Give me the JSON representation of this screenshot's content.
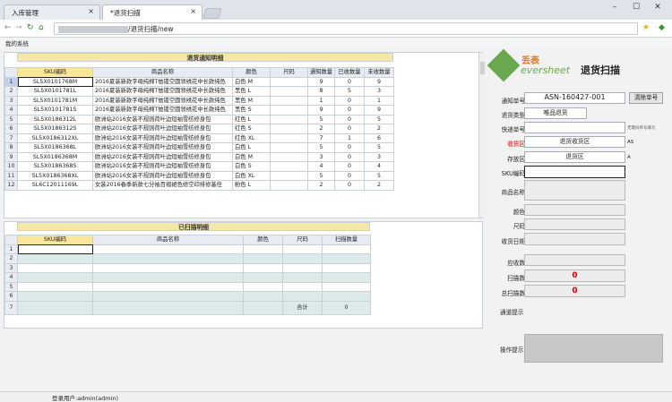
{
  "browser": {
    "tabs": [
      {
        "label": "入库管理"
      },
      {
        "label": "*退货扫描"
      }
    ],
    "tab_close": "×",
    "url_text": "/退货扫描/new",
    "bookmark": "我的系统",
    "win": {
      "min": "–",
      "max": "☐",
      "close": "✕"
    }
  },
  "notice_grid": {
    "title": "退货通知明细",
    "columns": [
      "SKU编码",
      "商品名称",
      "颜色",
      "尺码",
      "通知数量",
      "已收数量",
      "未收数量"
    ],
    "rows": [
      {
        "n": "1",
        "sku": "SL5X0101768M",
        "name": "2016夏装新款字母纯棉T恤镂空圆领绣花中长款纯色",
        "color": "白色 M",
        "size": "",
        "notice": "9",
        "recv": "0",
        "unrecv": "9"
      },
      {
        "n": "2",
        "sku": "SL5X0101781L",
        "name": "2016夏装新款字母纯棉T恤镂空圆领绣花中长款纯色",
        "color": "黑色 L",
        "size": "",
        "notice": "8",
        "recv": "5",
        "unrecv": "3"
      },
      {
        "n": "3",
        "sku": "SL5X0101781M",
        "name": "2016夏装新款字母纯棉T恤镂空圆领绣花中长款纯色",
        "color": "黑色 M",
        "size": "",
        "notice": "1",
        "recv": "0",
        "unrecv": "1"
      },
      {
        "n": "4",
        "sku": "SL5X0101781S",
        "name": "2016夏装新款字母纯棉T恤镂空圆领绣花中长款纯色",
        "color": "黑色 S",
        "size": "",
        "notice": "9",
        "recv": "0",
        "unrecv": "9"
      },
      {
        "n": "5",
        "sku": "SL5X0186312L",
        "name": "欧洲站2016女装不规则荷叶边短袖雪纺修身包",
        "color": "红色 L",
        "size": "",
        "notice": "5",
        "recv": "0",
        "unrecv": "5"
      },
      {
        "n": "6",
        "sku": "SL5X0186312S",
        "name": "欧洲站2016女装不规则荷叶边短袖雪纺修身包",
        "color": "红色 S",
        "size": "",
        "notice": "2",
        "recv": "0",
        "unrecv": "2"
      },
      {
        "n": "7",
        "sku": "SL5X0186312XL",
        "name": "欧洲站2016女装不规则荷叶边短袖雪纺修身包",
        "color": "红色 XL",
        "size": "",
        "notice": "7",
        "recv": "1",
        "unrecv": "6"
      },
      {
        "n": "8",
        "sku": "SL5X0186368L",
        "name": "欧洲站2016女装不规则荷叶边短袖雪纺修身包",
        "color": "白色 L",
        "size": "",
        "notice": "5",
        "recv": "0",
        "unrecv": "5"
      },
      {
        "n": "9",
        "sku": "SL5X0186368M",
        "name": "欧洲站2016女装不规则荷叶边短袖雪纺修身包",
        "color": "白色 M",
        "size": "",
        "notice": "3",
        "recv": "0",
        "unrecv": "3"
      },
      {
        "n": "10",
        "sku": "SL5X0186368S",
        "name": "欧洲站2016女装不规则荷叶边短袖雪纺修身包",
        "color": "白色 S",
        "size": "",
        "notice": "4",
        "recv": "0",
        "unrecv": "4"
      },
      {
        "n": "11",
        "sku": "SL5X0186368XL",
        "name": "欧洲站2016女装不规则荷叶边短袖雪纺修身包",
        "color": "白色 XL",
        "size": "",
        "notice": "5",
        "recv": "0",
        "unrecv": "5"
      },
      {
        "n": "12",
        "sku": "SL6C12011169L",
        "name": "女装2016春季新款七分袖百褶裙色修空印排修基任",
        "color": "粉色 L",
        "size": "",
        "notice": "2",
        "recv": "0",
        "unrecv": "2"
      }
    ]
  },
  "scan_grid": {
    "title": "已扫描明细",
    "columns": [
      "SKU编码",
      "商品名称",
      "颜色",
      "尺码",
      "扫描数量"
    ],
    "row_numbers": [
      "1",
      "2",
      "3",
      "4",
      "5",
      "6"
    ],
    "total_row": "7",
    "total_label": "合计",
    "total_value": "0"
  },
  "form": {
    "logo_text_1": "丢表",
    "logo_text_2": "eversheet",
    "title": "退货扫描",
    "notice_no_label": "通知单号",
    "notice_no": "ASN-160427-001",
    "clear_btn": "清除单号",
    "type_label": "退货类型",
    "type_value": "唯品退货",
    "express_label": "快递单号",
    "express_hint": "无需扫单号填写",
    "recv_area_label": "收货区",
    "recv_area_value": "退货收货区",
    "recv_suffix": "AS",
    "store_area_label": "存放区",
    "store_area_value": "退货区",
    "store_suffix": "A",
    "sku_label": "SKU编码",
    "goods_label": "商品名称",
    "color_label": "颜色",
    "size_label": "尺码",
    "date_label": "收货日期",
    "should_label": "应收数",
    "scanned_label": "扫描数",
    "scanned_value": "0",
    "total_scanned_label": "总扫描数",
    "total_scanned_value": "0",
    "pass_label": "通道提示",
    "op_label": "操作提示"
  },
  "status": {
    "user": "登录用户:admin(admin)"
  },
  "colors": {
    "accent_red": "#e00000",
    "header_yellow": "#f5e7a6",
    "cyan": "#dcebea"
  }
}
